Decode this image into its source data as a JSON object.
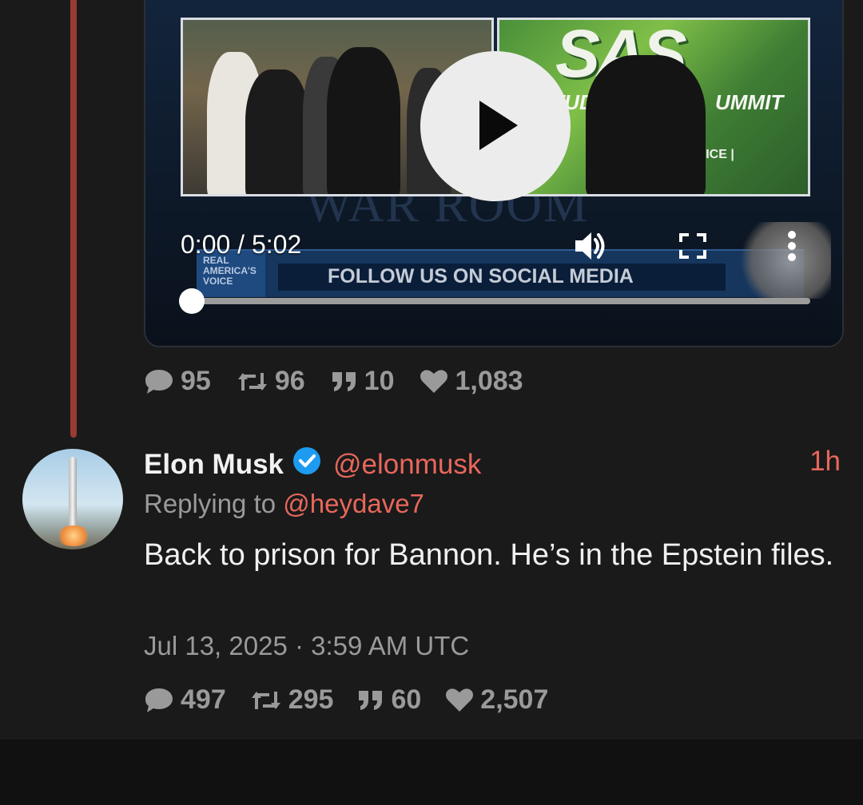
{
  "colors": {
    "background": "#1a1a1a",
    "accent": "#e8675c",
    "thread_line": "#9a3b33",
    "muted": "#9a9a9a",
    "verified": "#1d9bf0"
  },
  "quoted_tweet": {
    "video": {
      "time": "0:00 / 5:02",
      "progress": 0,
      "overlay_title": "SAS",
      "overlay_sub_left": "STUDEN",
      "overlay_sub_right": "UMMIT",
      "overlay_bar_text": "S VOICE | ",
      "banner_logo": "REAL AMERICA'S VOICE",
      "banner_text": "FOLLOW US ON SOCIAL MEDIA",
      "watermark": "WAR ROOM",
      "icons": {
        "play": "play-icon",
        "volume": "volume-icon",
        "fullscreen": "fullscreen-icon",
        "more": "more-vertical-icon"
      }
    },
    "stats": {
      "replies": "95",
      "retweets": "96",
      "quotes": "10",
      "likes": "1,083"
    }
  },
  "tweet": {
    "author_name": "Elon Musk",
    "author_handle": "@elonmusk",
    "relative_time": "1h",
    "replying_label": "Replying to",
    "replying_handle": "@heydave7",
    "body": "Back to prison for Bannon. He’s in the Epstein files.",
    "date": "Jul 13, 2025 · 3:59 AM UTC",
    "stats": {
      "replies": "497",
      "retweets": "295",
      "quotes": "60",
      "likes": "2,507"
    }
  }
}
